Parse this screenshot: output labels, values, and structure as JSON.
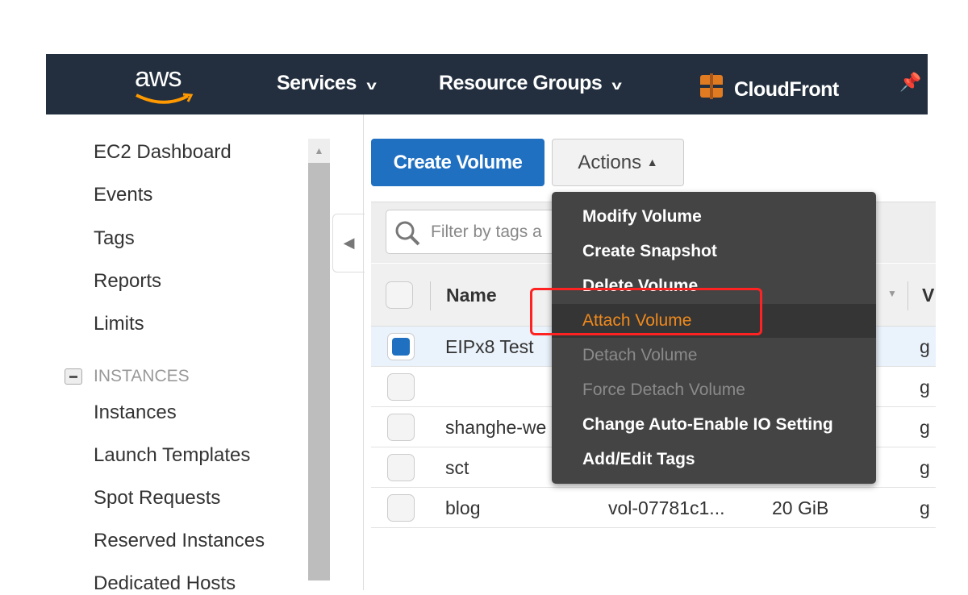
{
  "nav": {
    "logo": "aws",
    "services": "Services",
    "resource_groups": "Resource Groups",
    "cloudfront": "CloudFront",
    "brand_color": "#232f3e",
    "accent": "#ff9900"
  },
  "sidebar": {
    "items": [
      "EC2 Dashboard",
      "Events",
      "Tags",
      "Reports",
      "Limits"
    ],
    "section": "INSTANCES",
    "section_items": [
      "Instances",
      "Launch Templates",
      "Spot Requests",
      "Reserved Instances",
      "Dedicated Hosts"
    ]
  },
  "toolbar": {
    "create": "Create Volume",
    "actions": "Actions"
  },
  "filter": {
    "placeholder": "Filter by tags a"
  },
  "table": {
    "headers": {
      "name": "Name",
      "trunc": "V"
    },
    "rows": [
      {
        "name": "EIPx8 Test",
        "id": "",
        "size": "",
        "type": "g",
        "selected": true
      },
      {
        "name": "",
        "id": "",
        "size": "",
        "type": "g",
        "selected": false
      },
      {
        "name": "shanghe-we",
        "id": "",
        "size": "",
        "type": "g",
        "selected": false
      },
      {
        "name": "sct",
        "id": "",
        "size": "",
        "type": "g",
        "selected": false
      },
      {
        "name": "blog",
        "id": "vol-07781c1...",
        "size": "20 GiB",
        "type": "g",
        "selected": false
      }
    ]
  },
  "menu": {
    "items": [
      {
        "label": "Modify Volume",
        "state": "enabled"
      },
      {
        "label": "Create Snapshot",
        "state": "enabled"
      },
      {
        "label": "Delete Volume",
        "state": "enabled"
      },
      {
        "label": "Attach Volume",
        "state": "highlighted"
      },
      {
        "label": "Detach Volume",
        "state": "disabled"
      },
      {
        "label": "Force Detach Volume",
        "state": "disabled"
      },
      {
        "label": "Change Auto-Enable IO Setting",
        "state": "enabled"
      },
      {
        "label": "Add/Edit Tags",
        "state": "enabled"
      }
    ]
  },
  "annotation": {
    "color": "#ff2222"
  }
}
